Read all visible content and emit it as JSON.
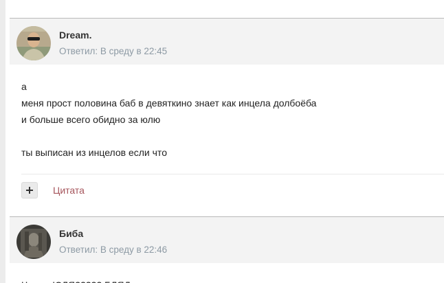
{
  "posts": [
    {
      "author": "Dream.",
      "meta": "Ответил: В среду в 22:45",
      "lines": [
        "а",
        "меня прост половина баб в девяткино знает как инцела долбоёба",
        "и больше всего обидно за юлю",
        "",
        "ты выписан из инцелов если что"
      ],
      "avatar_icon": "user-photo",
      "plus_icon": "plus-icon",
      "quote_label": "Цитата"
    },
    {
      "author": "Биба",
      "meta": "Ответил: В среду в 22:46",
      "lines": [
        "Что за ЮЛЯ????? БЛЯД"
      ],
      "avatar_icon": "user-photo"
    }
  ],
  "colors": {
    "header_bg": "#f3f3f3",
    "meta_text": "#8d9aa4",
    "quote_link": "#a5545b",
    "separator": "#b9b9b9"
  }
}
